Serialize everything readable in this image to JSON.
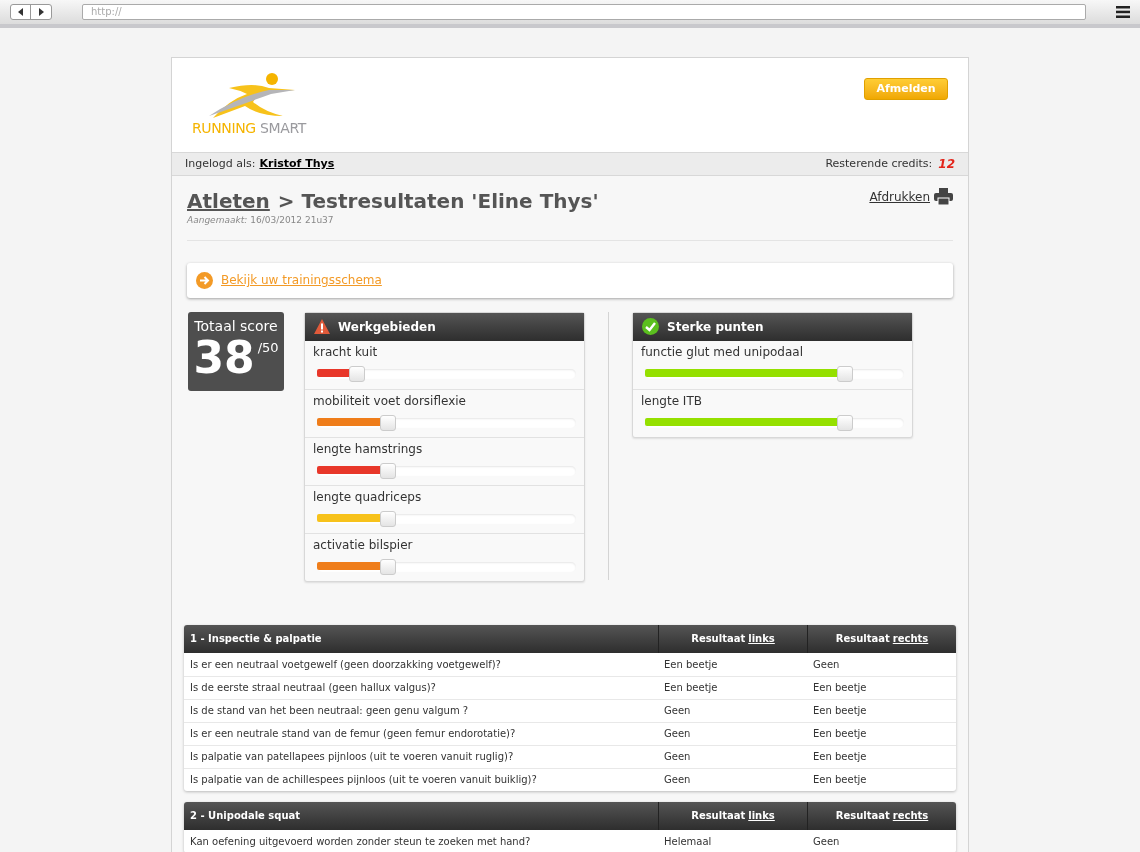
{
  "browser": {
    "url": "http://"
  },
  "header": {
    "logo_text_1": "RUNNING",
    "logo_text_2": "SMART",
    "logout_button": "Afmelden"
  },
  "user_bar": {
    "label": "Ingelogd als:",
    "user": "Kristof Thys",
    "credits_label": "Resterende credits:",
    "credits": "12"
  },
  "page": {
    "breadcrumb_link": "Atleten",
    "title": "> Testresultaten 'Eline Thys'",
    "created_label": "Aangemaakt:",
    "created": "16/03/2012 21u37",
    "print_link": "Afdrukken",
    "schedule_link": "Bekijk uw trainingsschema"
  },
  "score": {
    "label": "Totaal score",
    "value": "38",
    "max": "/50"
  },
  "panels": [
    {
      "kind": "warning",
      "title": "Werkgebieden",
      "items": [
        {
          "label": "kracht kuit",
          "level": 0.13,
          "color": "#e8372a"
        },
        {
          "label": "mobiliteit voet dorsiflexie",
          "level": 0.25,
          "color": "#ef7d1a"
        },
        {
          "label": "lengte hamstrings",
          "level": 0.25,
          "color": "#e8372a"
        },
        {
          "label": "lengte quadriceps",
          "level": 0.25,
          "color": "#f7c21b"
        },
        {
          "label": "activatie bilspier",
          "level": 0.25,
          "color": "#ef7d1a"
        }
      ]
    },
    {
      "kind": "success",
      "title": "Sterke punten",
      "items": [
        {
          "label": "functie glut med unipodaal",
          "level": 0.75,
          "color": "#95e000"
        },
        {
          "label": "lengte ITB",
          "level": 0.75,
          "color": "#95e000"
        }
      ]
    }
  ],
  "tables": [
    {
      "title": "1 - Inspectie & palpatie",
      "columns": [
        {
          "prefix": "Resultaat",
          "link": "links"
        },
        {
          "prefix": "Resultaat",
          "link": "rechts"
        }
      ],
      "rows": [
        [
          "Is er een neutraal voetgewelf (geen doorzakking voetgewelf)?",
          "Een beetje",
          "Geen"
        ],
        [
          "Is de eerste straal neutraal (geen hallux valgus)?",
          "Een beetje",
          "Een beetje"
        ],
        [
          "Is de stand van het been neutraal: geen genu valgum ?",
          "Geen",
          "Een beetje"
        ],
        [
          "Is er een neutrale stand van de femur (geen femur endorotatie)?",
          "Geen",
          "Een beetje"
        ],
        [
          "Is palpatie van patellapees pijnloos (uit te voeren vanuit ruglig)?",
          "Geen",
          "Een beetje"
        ],
        [
          "Is palpatie van de achillespees pijnloos (uit te voeren vanuit buiklig)?",
          "Geen",
          "Een beetje"
        ]
      ]
    },
    {
      "title": "2 - Unipodale squat",
      "columns": [
        {
          "prefix": "Resultaat",
          "link": "links"
        },
        {
          "prefix": "Resultaat",
          "link": "rechts"
        }
      ],
      "rows": [
        [
          "Kan oefening uitgevoerd worden zonder steun te zoeken met hand?",
          "Helemaal",
          "Geen"
        ]
      ]
    }
  ]
}
